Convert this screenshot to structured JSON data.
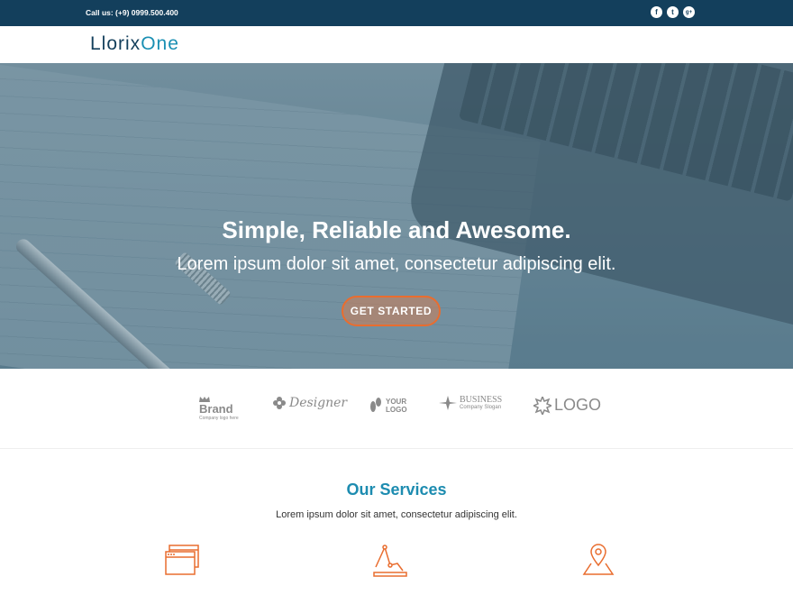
{
  "topbar": {
    "phone": "Call us: (+9) 0999.500.400",
    "socials": [
      {
        "name": "facebook-icon",
        "glyph": "f"
      },
      {
        "name": "twitter-icon",
        "glyph": "t"
      },
      {
        "name": "googleplus-icon",
        "glyph": "g+"
      }
    ]
  },
  "header": {
    "logo_part1": "Llorix",
    "logo_part2": "One"
  },
  "hero": {
    "title": "Simple, Reliable and Awesome.",
    "subtitle": "Lorem ipsum dolor sit amet, consectetur adipiscing elit.",
    "button": "GET STARTED"
  },
  "brands": [
    {
      "main": "Brand",
      "tag": "Company logo here"
    },
    {
      "main": "Designer"
    },
    {
      "main_line1": "YOUR",
      "main_line2": "LOGO"
    },
    {
      "main": "BUSINESS",
      "tag": "Company Slogan"
    },
    {
      "main": "LOGO"
    }
  ],
  "services": {
    "title": "Our Services",
    "subtitle": "Lorem ipsum dolor sit amet, consectetur adipiscing elit.",
    "icons": [
      "browser-windows-icon",
      "line-chart-icon",
      "map-pin-icon"
    ]
  },
  "colors": {
    "topbar": "#133f5c",
    "accent_orange": "#e96d2f",
    "accent_blue": "#1d8cb0"
  }
}
